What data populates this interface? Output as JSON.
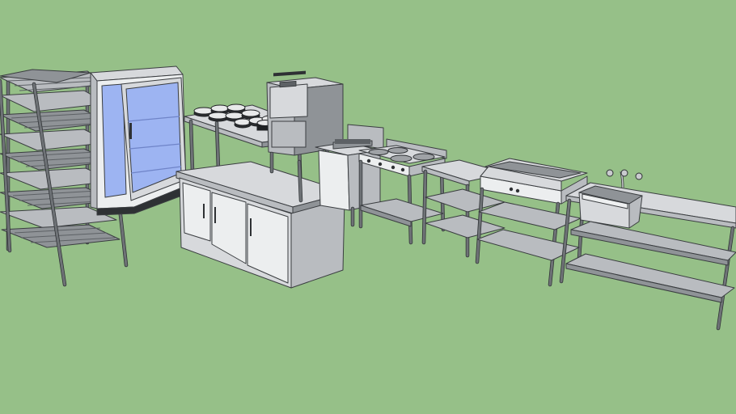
{
  "scene": {
    "background_color": "#96c088",
    "steel_light": "#d7d9dc",
    "steel_mid": "#b9bcc0",
    "steel_dark": "#8f9397",
    "outline_color": "#3a3d40",
    "glass_color": "#9db4f2",
    "items": [
      "bakery-rack",
      "glass-door-refrigerator",
      "work-table-with-plates",
      "cabinet-island",
      "double-deck-oven",
      "fryer",
      "gas-range",
      "prep-table",
      "griddle",
      "sink-table"
    ]
  }
}
